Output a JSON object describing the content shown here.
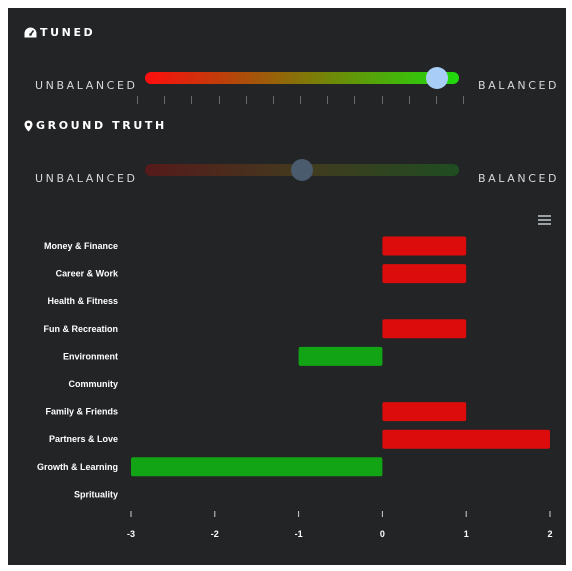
{
  "tuned": {
    "title": "TUNED",
    "icon": "dashboard-icon",
    "left_label": "UNBALANCED",
    "right_label": "BALANCED",
    "value": 0.93
  },
  "ground_truth": {
    "title": "GROUND TRUTH",
    "icon": "map-marker-icon",
    "left_label": "UNBALANCED",
    "right_label": "BALANCED",
    "value": 0.5
  },
  "chart_menu": {
    "icon": "hamburger-menu-icon"
  },
  "chart_data": {
    "type": "bar",
    "orientation": "horizontal",
    "categories": [
      "Money & Finance",
      "Career & Work",
      "Health & Fitness",
      "Fun & Recreation",
      "Environment",
      "Community",
      "Family & Friends",
      "Partners & Love",
      "Growth & Learning",
      "Sprituality"
    ],
    "values": [
      1,
      1,
      0,
      1,
      -1,
      0,
      1,
      2,
      -3,
      0
    ],
    "xlim": [
      -3,
      2
    ],
    "xticks": [
      -3,
      -2,
      -1,
      0,
      1,
      2
    ],
    "colors": {
      "positive": "#dd0c0c",
      "negative": "#12a414"
    },
    "grid": false,
    "legend": "none"
  }
}
